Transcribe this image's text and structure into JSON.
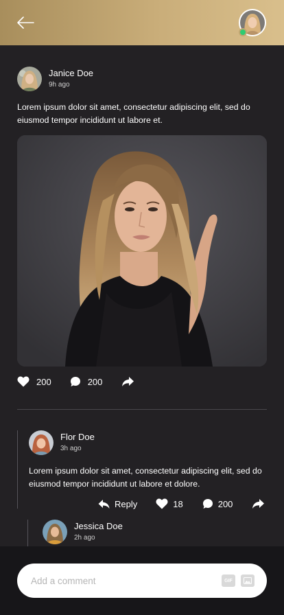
{
  "colors": {
    "header_gradient_start": "#a88e5c",
    "header_gradient_end": "#d9bf8c",
    "background": "#232124",
    "footer": "#171619",
    "online": "#2ecc71"
  },
  "header": {
    "back_icon": "arrow-left-icon",
    "user_online": true
  },
  "post": {
    "author": "Janice Doe",
    "time": "9h ago",
    "text": "Lorem ipsum dolor sit amet, consectetur adipiscing elit, sed do eiusmod tempor incididunt ut labore et.",
    "likes": "200",
    "comments": "200"
  },
  "comments": [
    {
      "author": "Flor Doe",
      "time": "3h ago",
      "text": "Lorem ipsum dolor sit amet, consectetur adipiscing elit, sed do eiusmod tempor incididunt ut labore et dolore.",
      "reply_label": "Reply",
      "likes": "18",
      "comments": "200"
    },
    {
      "author": "Jessica Doe",
      "time": "2h ago"
    }
  ],
  "composer": {
    "placeholder": "Add a comment",
    "gif_label": "GIF"
  }
}
